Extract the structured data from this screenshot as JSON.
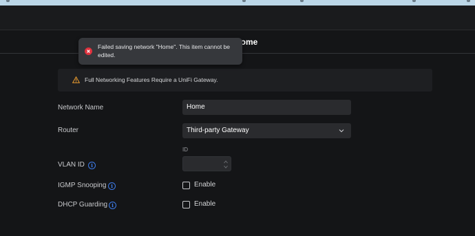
{
  "page": {
    "title_visible": "ome"
  },
  "toast": {
    "message": "Failed saving network \"Home\". This item cannot be edited.",
    "icon": "error-icon",
    "color": "#e0323e"
  },
  "banner": {
    "text": "Full Networking Features Require a UniFi Gateway.",
    "icon": "warning-icon",
    "icon_color": "#f0a030"
  },
  "form": {
    "network_name": {
      "label": "Network Name",
      "value": "Home"
    },
    "router": {
      "label": "Router",
      "selected": "Third-party Gateway"
    },
    "vlan_id": {
      "label": "VLAN ID",
      "caption": "ID",
      "value": ""
    },
    "igmp_snooping": {
      "label": "IGMP Snooping",
      "checkbox_label": "Enable",
      "checked": false
    },
    "dhcp_guarding": {
      "label": "DHCP Guarding",
      "checkbox_label": "Enable",
      "checked": false
    }
  },
  "colors": {
    "background": "#141517",
    "accent_info": "#3d7be8"
  }
}
